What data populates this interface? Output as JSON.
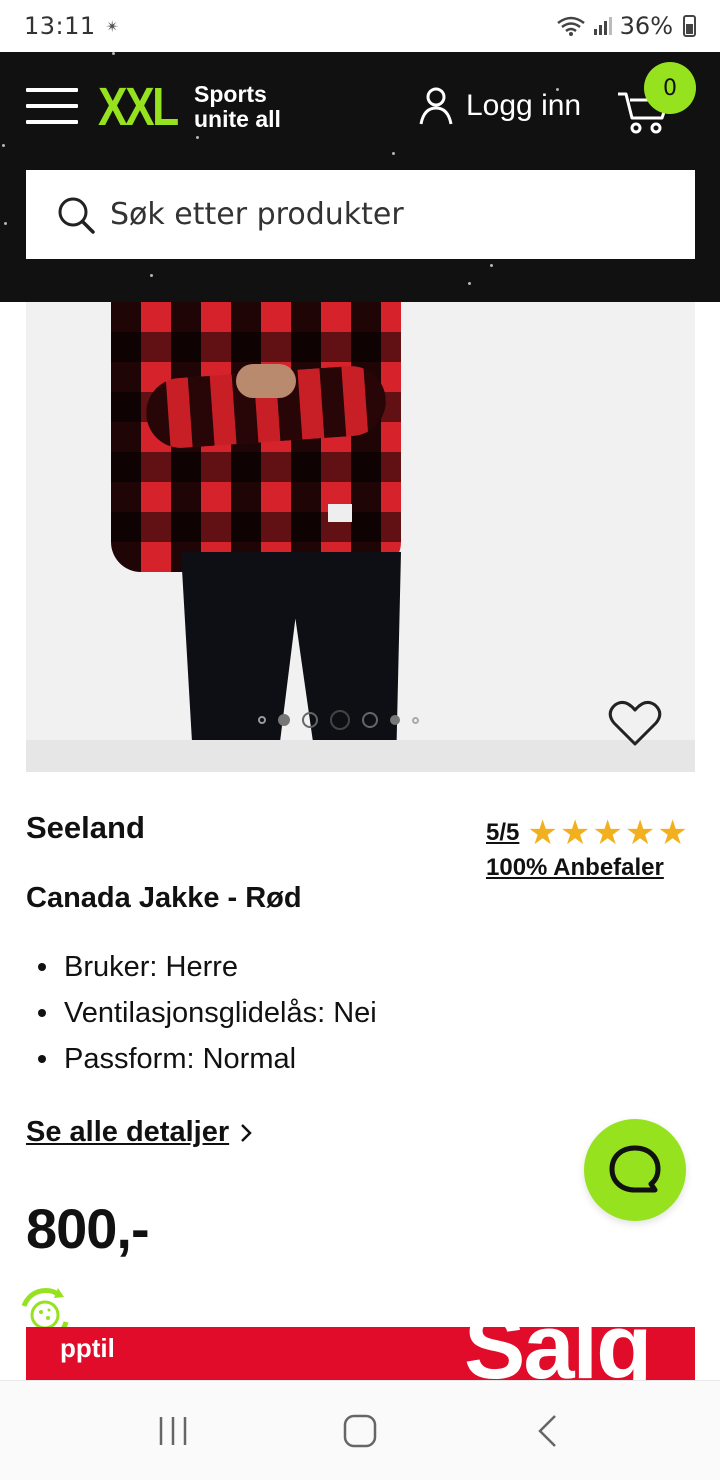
{
  "status_bar": {
    "time": "13:11",
    "notification_dots": "✴",
    "battery_percent": "36%"
  },
  "header": {
    "logo_mark": "XXL",
    "logo_tagline_line1": "Sports",
    "logo_tagline_line2": "unite all",
    "login_label": "Logg inn",
    "cart_count": "0",
    "brand_color": "#96e21f",
    "background_color": "#111111"
  },
  "search": {
    "placeholder": "Søk etter produkter"
  },
  "product": {
    "brand": "Seeland",
    "title": "Canada Jakke - Rød",
    "rating": "5/5",
    "stars": 5,
    "recommend": "100% Anbefaler",
    "features": [
      "Bruker: Herre",
      "Ventilasjonsglidelås: Nei",
      "Passform: Normal"
    ],
    "details_link": "Se alle detaljer",
    "price": "800,-",
    "image_carousel": {
      "total_dots": 7,
      "active_index": 3
    }
  },
  "sale_banner": {
    "upto_text": "pptil",
    "big_text": "Salg",
    "color": "#e10b2a"
  },
  "icons": {
    "star_color": "#f2b01e",
    "chat_button_color": "#96e21f"
  }
}
